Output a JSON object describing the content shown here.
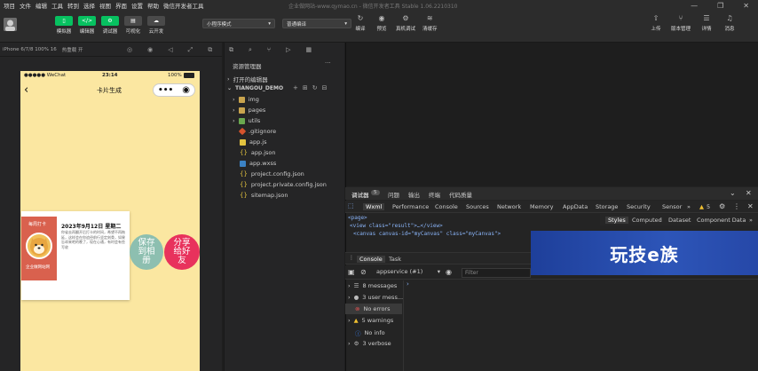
{
  "menu": [
    "项目",
    "文件",
    "编辑",
    "工具",
    "转到",
    "选择",
    "视图",
    "界面",
    "设置",
    "帮助",
    "微信开发者工具"
  ],
  "window_title": "企业做网站-www.qymao.cn - 微信开发者工具 Stable 1.06.2210310",
  "toolbar": {
    "left_buttons": [
      {
        "label": "模拟器",
        "icon": "phone-icon"
      },
      {
        "label": "编辑器",
        "icon": "code-icon"
      },
      {
        "label": "调试器",
        "icon": "bug-icon"
      },
      {
        "label": "可视化",
        "icon": "visual-icon"
      },
      {
        "label": "云开发",
        "icon": "cloud-icon"
      }
    ],
    "mode_select": "小程序模式",
    "compile_select": "普通编译",
    "right_buttons": [
      {
        "label": "编译",
        "icon": "refresh-icon"
      },
      {
        "label": "预览",
        "icon": "eye-icon"
      },
      {
        "label": "真机调试",
        "icon": "gear-icon"
      },
      {
        "label": "清缓存",
        "icon": "layers-icon"
      }
    ],
    "far_right": [
      {
        "label": "上传",
        "icon": "upload-icon"
      },
      {
        "label": "版本管理",
        "icon": "branch-icon"
      },
      {
        "label": "详情",
        "icon": "detail-icon"
      },
      {
        "label": "消息",
        "icon": "bell-icon"
      }
    ]
  },
  "simulator": {
    "device": "iPhone 6/7/8 100% 16",
    "hotreload": "热重载 开",
    "status_carrier": "●●●●● WeChat",
    "status_time": "23:14",
    "status_battery": "100%",
    "nav_title": "卡片生成",
    "card": {
      "tag": "每周打卡",
      "date": "2023年9月12日 星期二",
      "text": "你省去再翻开后打卡的时间，希望不再拖延，这样会在你追径前行坚定刻骨，如果忘却来吧的晚了，现在心通，有时会有些写收",
      "brand": "企业做网站网"
    },
    "save_label": "保存到相册",
    "share_label": "分享给好友"
  },
  "file_panel": {
    "title": "资源管理器",
    "open_editors": "打开的编辑器",
    "project": "TIANGOU_DEMO",
    "items": [
      {
        "name": "img",
        "type": "folder"
      },
      {
        "name": "pages",
        "type": "folder"
      },
      {
        "name": "utils",
        "type": "folder"
      },
      {
        "name": ".gitignore",
        "type": "git"
      },
      {
        "name": "app.js",
        "type": "js"
      },
      {
        "name": "app.json",
        "type": "json"
      },
      {
        "name": "app.wxss",
        "type": "wxss"
      },
      {
        "name": "project.config.json",
        "type": "json"
      },
      {
        "name": "project.private.config.json",
        "type": "json"
      },
      {
        "name": "sitemap.json",
        "type": "json"
      }
    ]
  },
  "devtools": {
    "top_tabs": [
      "调试器",
      "5",
      "问题",
      "输出",
      "终端",
      "代码质量"
    ],
    "panels": [
      "Wxml",
      "Performance",
      "Console",
      "Sources",
      "Network",
      "Memory",
      "AppData",
      "Storage",
      "Security",
      "Sensor"
    ],
    "warn_count": "5",
    "style_tabs": [
      "Styles",
      "Computed",
      "Dataset",
      "Component Data"
    ],
    "wxml_lines": [
      "<page>",
      "<view class=\"result\">…</view>",
      "<canvas canvas-id=\"myCanvas\" class=\"myCanvas\">"
    ],
    "console_tabs": [
      "Console",
      "Task"
    ],
    "context": "appservice (#1)",
    "filter_placeholder": "Filter",
    "console_items": [
      {
        "label": "8 messages",
        "icon": "list-icon",
        "color": "#bbb"
      },
      {
        "label": "3 user mess...",
        "icon": "user-icon",
        "color": "#bbb"
      },
      {
        "label": "No errors",
        "icon": "error-icon",
        "color": "#e05252"
      },
      {
        "label": "5 warnings",
        "icon": "warning-icon",
        "color": "#f0c030"
      },
      {
        "label": "No info",
        "icon": "info-icon",
        "color": "#3b82f6"
      },
      {
        "label": "3 verbose",
        "icon": "verbose-icon",
        "color": "#bbb"
      }
    ],
    "banner_text": "玩技e族"
  }
}
